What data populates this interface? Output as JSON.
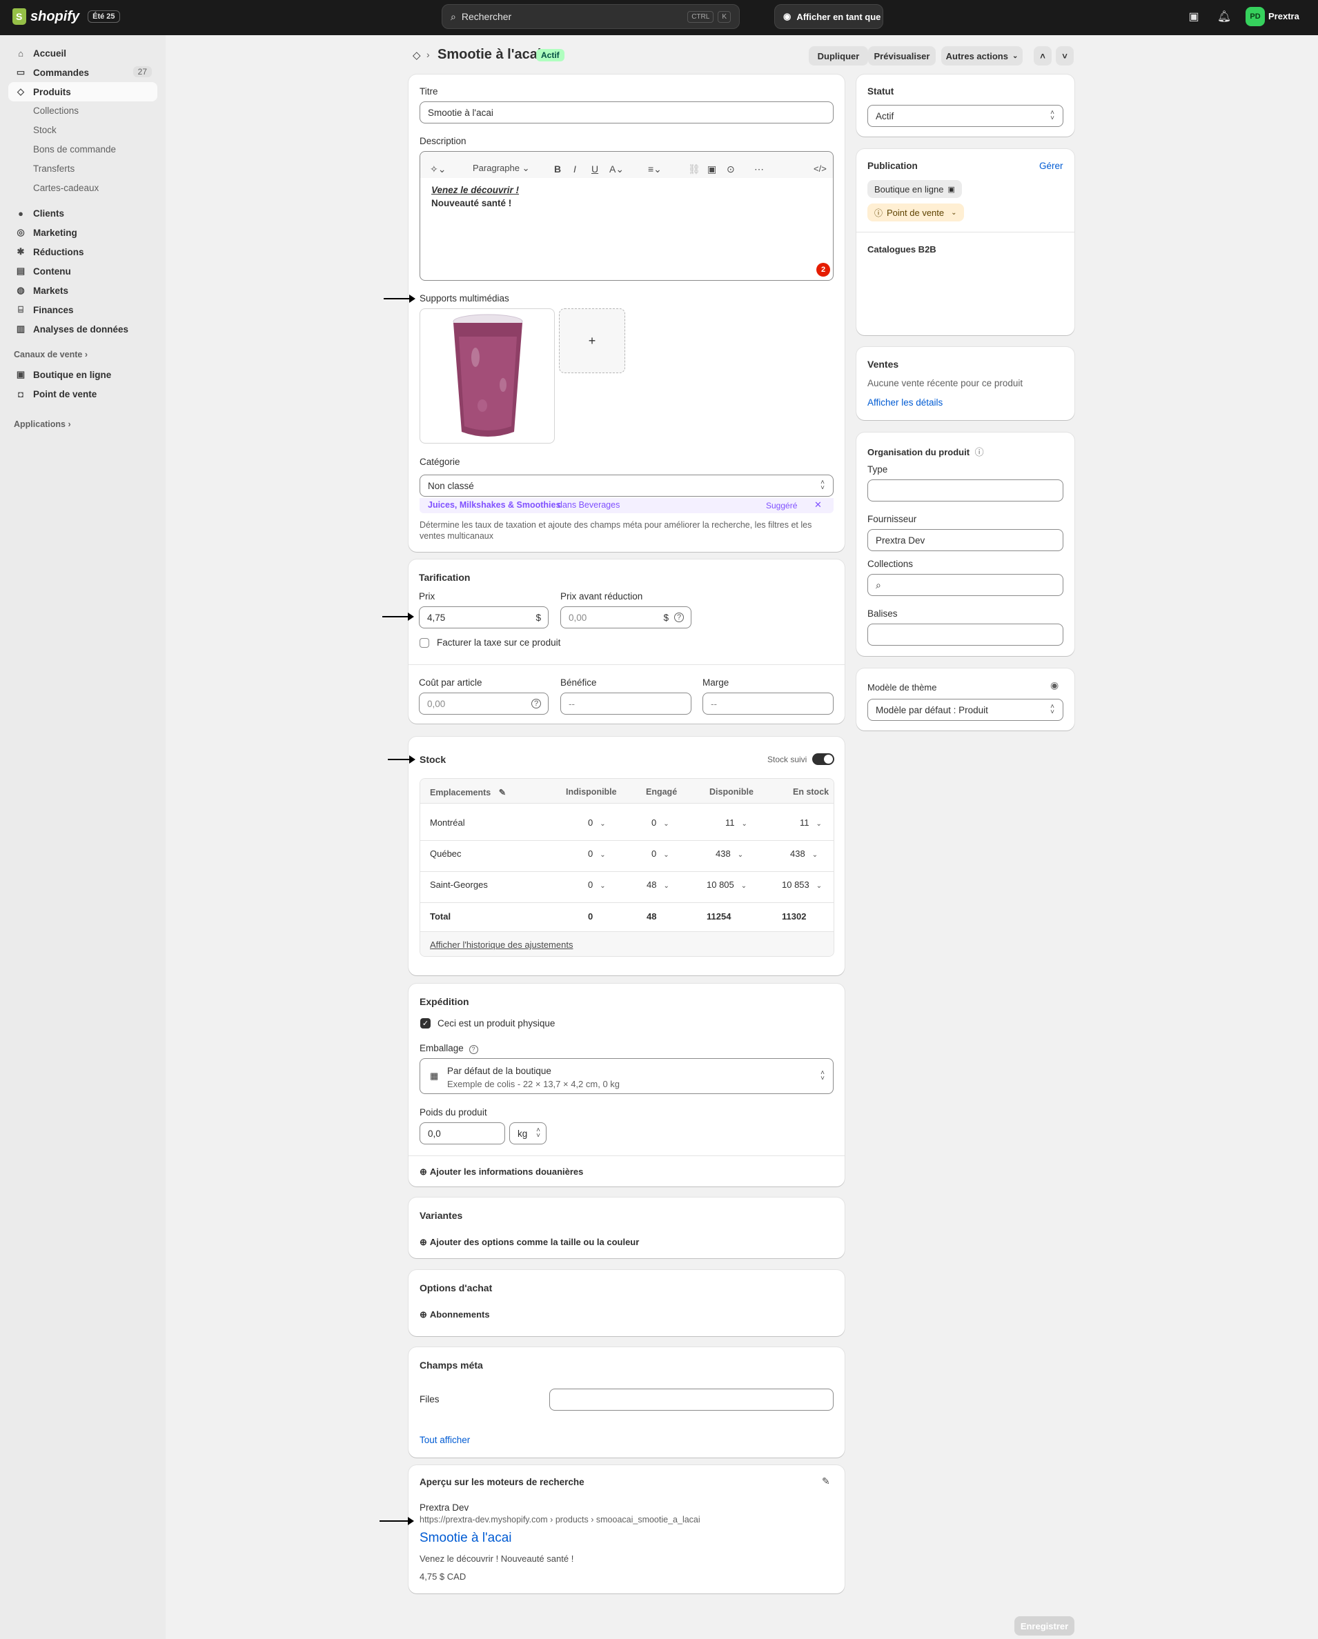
{
  "topbar": {
    "logo": "shopify",
    "edition": "Été 25",
    "search_placeholder": "Rechercher",
    "search_kbd1": "CTRL",
    "search_kbd2": "K",
    "view_as": "Afficher en tant que",
    "avatar_initials": "PD",
    "username": "Prextra"
  },
  "sidebar": {
    "home": "Accueil",
    "orders": "Commandes",
    "orders_count": "27",
    "products": "Produits",
    "sub": [
      "Collections",
      "Stock",
      "Bons de commande",
      "Transferts",
      "Cartes-cadeaux"
    ],
    "customers": "Clients",
    "marketing": "Marketing",
    "discounts": "Réductions",
    "content": "Contenu",
    "markets": "Markets",
    "finance": "Finances",
    "analytics": "Analyses de données",
    "sales_channels": "Canaux de vente",
    "online_store": "Boutique en ligne",
    "pos": "Point de vente",
    "apps": "Applications"
  },
  "header": {
    "title": "Smootie à l'acai",
    "status_badge": "Actif",
    "duplicate": "Dupliquer",
    "preview": "Prévisualiser",
    "more_actions": "Autres actions"
  },
  "main": {
    "title_label": "Titre",
    "title_value": "Smootie à l'acai",
    "description_label": "Description",
    "paragraph": "Paragraphe",
    "desc_line1": "Venez le découvrir !",
    "desc_line2": "Nouveauté santé !",
    "desc_badge": "2",
    "media_label": "Supports multimédias",
    "add_media": "+",
    "category_label": "Catégorie",
    "category_value": "Non classé",
    "suggest_strong": "Juices, Milkshakes & Smoothies",
    "suggest_in": "dans Beverages",
    "suggest_tag": "Suggéré",
    "category_help": "Détermine les taux de taxation et ajoute des champs méta pour améliorer la recherche, les filtres et les ventes multicanaux"
  },
  "pricing": {
    "heading": "Tarification",
    "price_label": "Prix",
    "price_value": "4,75",
    "currency": "$",
    "compare_label": "Prix avant réduction",
    "compare_value": "0,00",
    "tax_label": "Facturer la taxe sur ce produit",
    "cost_label": "Coût par article",
    "cost_value": "0,00",
    "profit_label": "Bénéfice",
    "profit_value": "--",
    "margin_label": "Marge",
    "margin_value": "--"
  },
  "stock": {
    "heading": "Stock",
    "tracked": "Stock suivi",
    "columns": [
      "Emplacements",
      "Indisponible",
      "Engagé",
      "Disponible",
      "En stock"
    ],
    "rows": [
      {
        "loc": "Montréal",
        "unavail": "0",
        "committed": "0",
        "available": "11",
        "onhand": "11"
      },
      {
        "loc": "Québec",
        "unavail": "0",
        "committed": "0",
        "available": "438",
        "onhand": "438"
      },
      {
        "loc": "Saint-Georges",
        "unavail": "0",
        "committed": "48",
        "available": "10 805",
        "onhand": "10 853"
      }
    ],
    "total": {
      "loc": "Total",
      "unavail": "0",
      "committed": "48",
      "available": "11254",
      "onhand": "11302"
    },
    "history_link": "Afficher l'historique des ajustements"
  },
  "shipping": {
    "heading": "Expédition",
    "physical": "Ceci est un produit physique",
    "packaging_label": "Emballage",
    "packaging_value": "Par défaut de la boutique",
    "packaging_sub": "Exemple de colis - 22 × 13,7 × 4,2 cm, 0 kg",
    "weight_label": "Poids du produit",
    "weight_value": "0,0",
    "weight_unit": "kg",
    "customs": "Ajouter les informations douanières"
  },
  "variants": {
    "heading": "Variantes",
    "add": "Ajouter des options comme la taille ou la couleur"
  },
  "purchase": {
    "heading": "Options d'achat",
    "subs": "Abonnements"
  },
  "metafields": {
    "heading": "Champs méta",
    "files": "Files",
    "show_all": "Tout afficher"
  },
  "seo": {
    "heading": "Aperçu sur les moteurs de recherche",
    "store": "Prextra Dev",
    "url": "https://prextra-dev.myshopify.com › products › smooacai_smootie_a_lacai",
    "title": "Smootie à l'acai",
    "desc": "Venez le découvrir ! Nouveauté santé !",
    "price": "4,75 $ CAD"
  },
  "right": {
    "status_heading": "Statut",
    "status_value": "Actif",
    "publication_heading": "Publication",
    "manage": "Gérer",
    "chip_online": "Boutique en ligne",
    "chip_pos": "Point de vente",
    "b2b": "Catalogues B2B",
    "sales_heading": "Ventes",
    "sales_text": "Aucune vente récente pour ce produit",
    "sales_link": "Afficher les détails",
    "org_heading": "Organisation du produit",
    "type_label": "Type",
    "vendor_label": "Fournisseur",
    "vendor_value": "Prextra Dev",
    "collections_label": "Collections",
    "tags_label": "Balises",
    "theme_heading": "Modèle de thème",
    "theme_value": "Modèle par défaut : Produit"
  },
  "footer": {
    "save": "Enregistrer"
  },
  "colors": {
    "accent": "#005bd3",
    "topbar": "#1a1a1a",
    "badge_green": "#affebf",
    "suggest": "#8051ff"
  }
}
